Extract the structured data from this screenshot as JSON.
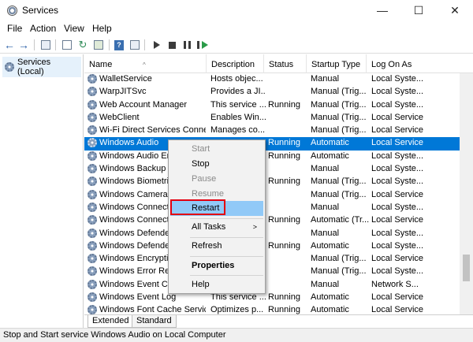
{
  "window": {
    "title": "Services",
    "controls": {
      "minimize": "—",
      "maximize": "☐",
      "close": "✕"
    }
  },
  "menu": [
    "File",
    "Action",
    "View",
    "Help"
  ],
  "toolbar": {
    "icons": [
      "back-arrow-icon",
      "forward-arrow-icon",
      "show-hide-tree-icon",
      "properties-icon",
      "refresh-icon",
      "export-list-icon",
      "help-book-icon",
      "show-hide-action-pane-icon",
      "start-service-icon",
      "stop-service-icon",
      "pause-service-icon",
      "restart-service-icon"
    ],
    "help_glyph": "?"
  },
  "tree": {
    "root": "Services (Local)"
  },
  "columns": {
    "name": "Name",
    "description": "Description",
    "status": "Status",
    "startup": "Startup Type",
    "logon": "Log On As",
    "sort_indicator": "^"
  },
  "services": [
    {
      "name": "WalletService",
      "description": "Hosts objec...",
      "status": "",
      "startup": "Manual",
      "logon": "Local Syste..."
    },
    {
      "name": "WarpJITSvc",
      "description": "Provides a JI...",
      "status": "",
      "startup": "Manual (Trig...",
      "logon": "Local Syste..."
    },
    {
      "name": "Web Account Manager",
      "description": "This service ...",
      "status": "Running",
      "startup": "Manual (Trig...",
      "logon": "Local Syste..."
    },
    {
      "name": "WebClient",
      "description": "Enables Win...",
      "status": "",
      "startup": "Manual (Trig...",
      "logon": "Local Service"
    },
    {
      "name": "Wi-Fi Direct Services Conne...",
      "description": "Manages co...",
      "status": "",
      "startup": "Manual (Trig...",
      "logon": "Local Service"
    },
    {
      "name": "Windows Audio",
      "description": "",
      "status": "Running",
      "startup": "Automatic",
      "logon": "Local Service",
      "selected": true
    },
    {
      "name": "Windows Audio En",
      "description": "",
      "status": "Running",
      "startup": "Automatic",
      "logon": "Local Syste..."
    },
    {
      "name": "Windows Backup",
      "description": "",
      "status": "",
      "startup": "Manual",
      "logon": "Local Syste..."
    },
    {
      "name": "Windows Biometri",
      "description": "",
      "status": "Running",
      "startup": "Manual (Trig...",
      "logon": "Local Syste..."
    },
    {
      "name": "Windows Camera F",
      "description": "",
      "status": "",
      "startup": "Manual (Trig...",
      "logon": "Local Service"
    },
    {
      "name": "Windows Connect",
      "description": "",
      "status": "",
      "startup": "Manual",
      "logon": "Local Syste..."
    },
    {
      "name": "Windows Connecti",
      "description": "",
      "status": "Running",
      "startup": "Automatic (Tr...",
      "logon": "Local Service"
    },
    {
      "name": "Windows Defender",
      "description": "",
      "status": "",
      "startup": "Manual",
      "logon": "Local Syste..."
    },
    {
      "name": "Windows Defender",
      "description": "",
      "status": "Running",
      "startup": "Automatic",
      "logon": "Local Syste..."
    },
    {
      "name": "Windows Encryptic",
      "description": "",
      "status": "",
      "startup": "Manual (Trig...",
      "logon": "Local Service"
    },
    {
      "name": "Windows Error Rep",
      "description": "",
      "status": "",
      "startup": "Manual (Trig...",
      "logon": "Local Syste..."
    },
    {
      "name": "Windows Event Co",
      "description": "",
      "status": "",
      "startup": "Manual",
      "logon": "Network S..."
    },
    {
      "name": "Windows Event Log",
      "description": "This service ...",
      "status": "Running",
      "startup": "Automatic",
      "logon": "Local Service"
    },
    {
      "name": "Windows Font Cache Service",
      "description": "Optimizes p...",
      "status": "Running",
      "startup": "Automatic",
      "logon": "Local Service"
    }
  ],
  "tabs": [
    "Extended",
    "Standard"
  ],
  "context_menu": {
    "start": "Start",
    "stop": "Stop",
    "pause": "Pause",
    "resume": "Resume",
    "restart": "Restart",
    "all_tasks": "All Tasks",
    "submenu_arrow": ">",
    "refresh": "Refresh",
    "properties": "Properties",
    "help": "Help"
  },
  "status_text": "Stop and Start service Windows Audio on Local Computer"
}
